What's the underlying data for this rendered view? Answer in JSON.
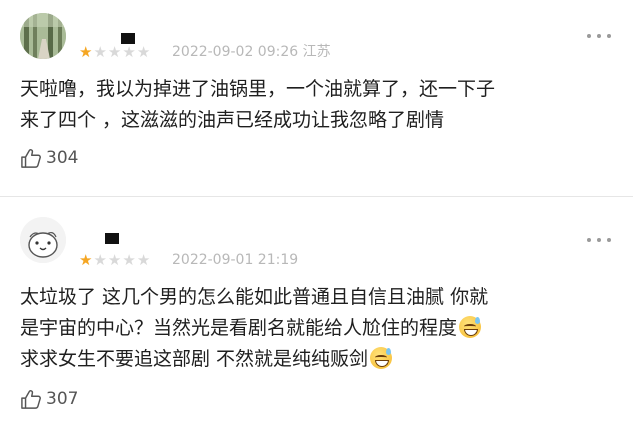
{
  "comments": [
    {
      "rating": 1,
      "date": "2022-09-02 09:26",
      "location": "江苏",
      "lines": [
        "天啦噜，我以为掉进了油锅里，一个油就算了，还一下子",
        "来了四个 ，这滋滋的油声已经成功让我忽略了剧情"
      ],
      "likes": "304"
    },
    {
      "rating": 1,
      "date": "2022-09-01 21:19",
      "location": "",
      "lines": [
        "太垃圾了 这几个男的怎么能如此普通且自信且油腻 你就",
        "是宇宙的中心？当然光是看剧名就能给人尬住的程度",
        "求求女生不要追这部剧 不然就是纯纯贩剑"
      ],
      "likes": "307"
    }
  ],
  "icons": {
    "thumb": "thumbs-up-icon",
    "more": "more-icon",
    "emoji": "sweat-smile-emoji"
  },
  "colors": {
    "star": "#f5a623",
    "star_off": "#d9d9d9",
    "meta": "#b8b8b8"
  }
}
